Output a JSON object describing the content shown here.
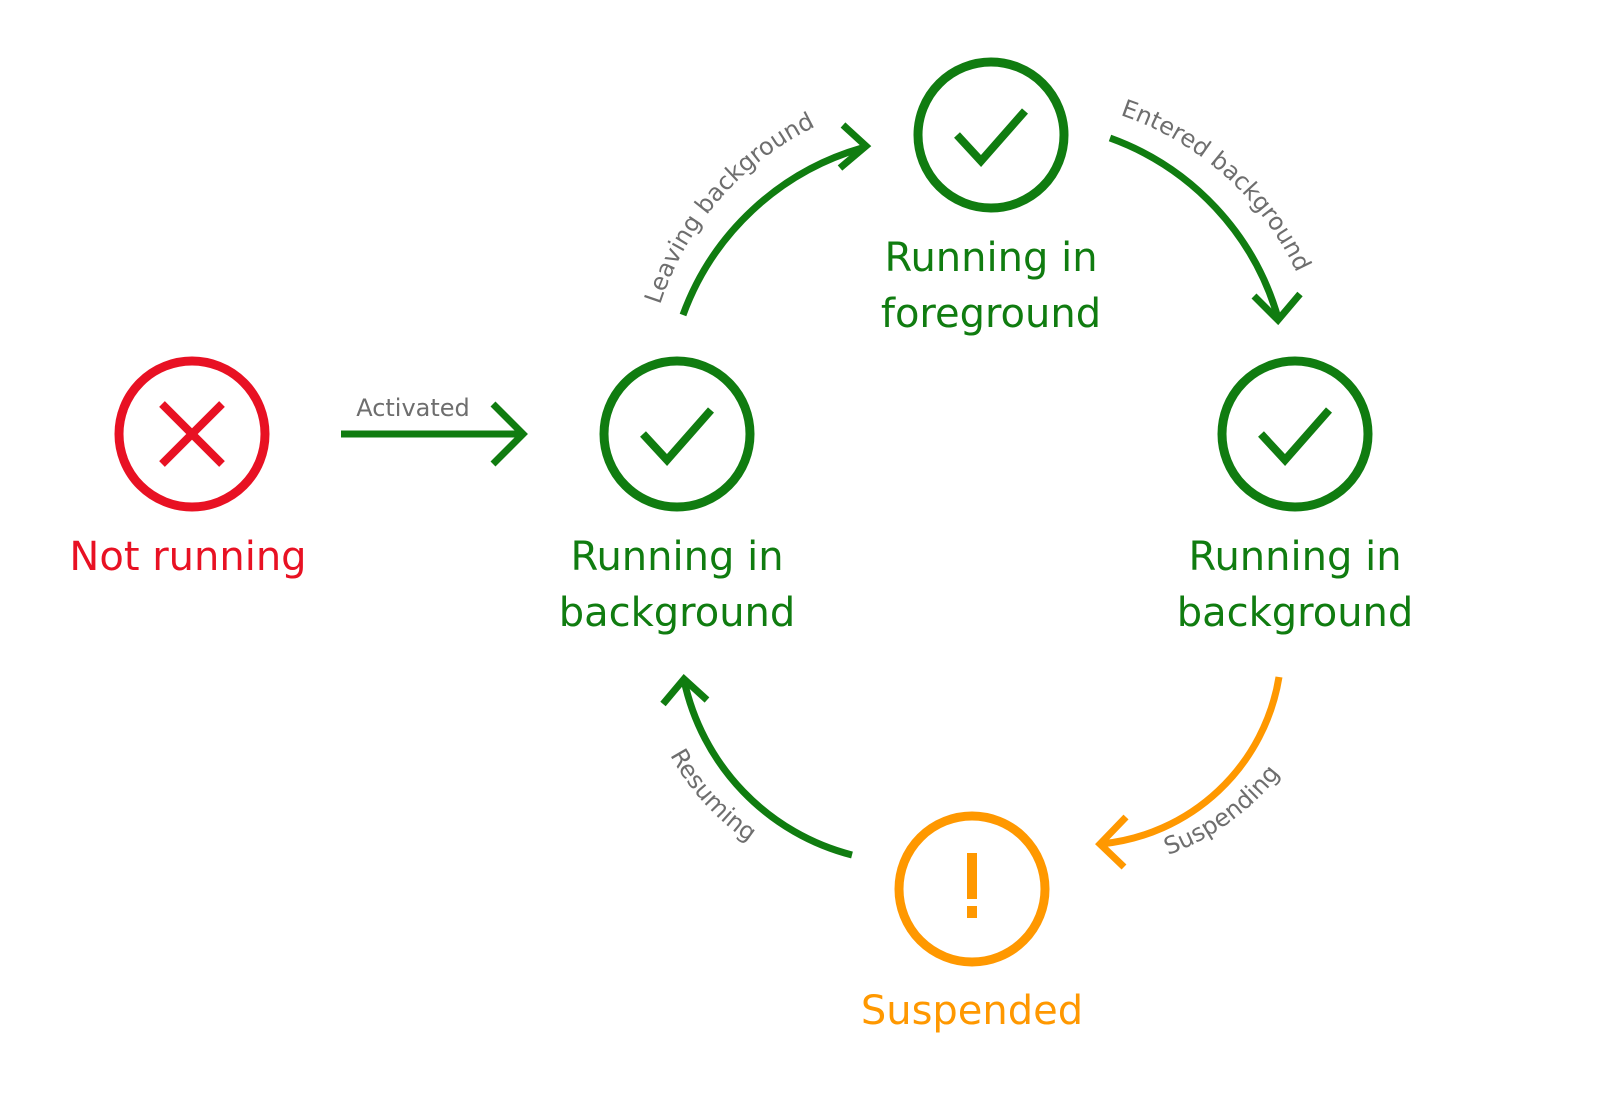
{
  "colors": {
    "green": "#107c10",
    "red": "#e81123",
    "orange": "#ff9800",
    "label_gray": "#6e6e6e"
  },
  "states": [
    {
      "id": "not-running",
      "icon": "x-icon",
      "color": "red",
      "lines": [
        "Not running"
      ]
    },
    {
      "id": "running-in-background-left",
      "icon": "check-icon",
      "color": "green",
      "lines": [
        "Running in",
        "background"
      ]
    },
    {
      "id": "running-in-foreground",
      "icon": "check-icon",
      "color": "green",
      "lines": [
        "Running in",
        "foreground"
      ]
    },
    {
      "id": "running-in-background-right",
      "icon": "check-icon",
      "color": "green",
      "lines": [
        "Running in",
        "background"
      ]
    },
    {
      "id": "suspended",
      "icon": "exclamation-icon",
      "color": "orange",
      "lines": [
        "Suspended"
      ]
    }
  ],
  "transitions": [
    {
      "id": "activated",
      "label": "Activated",
      "from": "not-running",
      "to": "running-in-background-left",
      "color": "green"
    },
    {
      "id": "leaving-background",
      "label": "Leaving background",
      "from": "running-in-background-left",
      "to": "running-in-foreground",
      "color": "green"
    },
    {
      "id": "entered-background",
      "label": "Entered background",
      "from": "running-in-foreground",
      "to": "running-in-background-right",
      "color": "green"
    },
    {
      "id": "suspending",
      "label": "Suspending",
      "from": "running-in-background-right",
      "to": "suspended",
      "color": "orange"
    },
    {
      "id": "resuming",
      "label": "Resuming",
      "from": "suspended",
      "to": "running-in-background-left",
      "color": "green"
    }
  ]
}
